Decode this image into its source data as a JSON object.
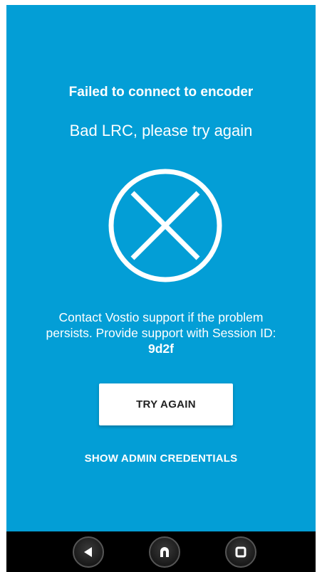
{
  "error": {
    "title": "Failed to connect to encoder",
    "subtitle": "Bad LRC, please try again",
    "icon": "close-circle-icon",
    "message_prefix": "Contact Vostio support if the problem persists. Provide support with Session ID: ",
    "session_id": "9d2f"
  },
  "actions": {
    "try_again_label": "TRY AGAIN",
    "admin_credentials_label": "SHOW ADMIN CREDENTIALS"
  },
  "navbar": {
    "back_icon": "back-icon",
    "home_icon": "home-icon",
    "recents_icon": "recents-icon"
  },
  "colors": {
    "background": "#039ed6",
    "text": "#ffffff",
    "button_bg": "#ffffff",
    "button_text": "#222222",
    "navbar_bg": "#000000"
  }
}
